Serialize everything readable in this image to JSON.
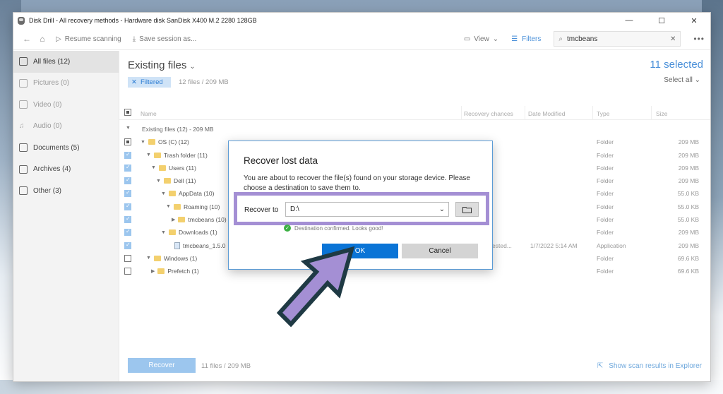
{
  "window": {
    "title": "Disk Drill - All recovery methods - Hardware disk SanDisk X400 M.2 2280 128GB"
  },
  "toolbar": {
    "resume_label": "Resume scanning",
    "save_label": "Save session as...",
    "view_label": "View",
    "filters_label": "Filters",
    "search_value": "tmcbeans"
  },
  "sidebar": {
    "items": [
      {
        "label": "All files (12)"
      },
      {
        "label": "Pictures (0)"
      },
      {
        "label": "Video (0)"
      },
      {
        "label": "Audio (0)"
      },
      {
        "label": "Documents (5)"
      },
      {
        "label": "Archives (4)"
      },
      {
        "label": "Other (3)"
      }
    ]
  },
  "main": {
    "heading": "Existing files",
    "filtered_label": "Filtered",
    "files_info": "12 files / 209 MB",
    "selected_count": "11 selected",
    "select_all": "Select all"
  },
  "table": {
    "headers": {
      "name": "Name",
      "chances": "Recovery chances",
      "date": "Date Modified",
      "type": "Type",
      "size": "Size"
    },
    "group_label": "Existing files (12) - 209 MB",
    "rows": [
      {
        "name": "OS (C) (12)",
        "type": "Folder",
        "size": "209 MB"
      },
      {
        "name": "Trash folder (11)",
        "type": "Folder",
        "size": "209 MB"
      },
      {
        "name": "Users (11)",
        "type": "Folder",
        "size": "209 MB"
      },
      {
        "name": "Dell (11)",
        "type": "Folder",
        "size": "209 MB"
      },
      {
        "name": "AppData (10)",
        "type": "Folder",
        "size": "55.0 KB"
      },
      {
        "name": "Roaming (10)",
        "type": "Folder",
        "size": "55.0 KB"
      },
      {
        "name": "tmcbeans (10)",
        "type": "Folder",
        "size": "55.0 KB"
      },
      {
        "name": "Downloads (1)",
        "type": "Folder",
        "size": "209 MB"
      },
      {
        "name": "tmcbeans_1.5.0",
        "chance": "ested...",
        "date": "1/7/2022 5:14 AM",
        "type": "Application",
        "size": "209 MB"
      },
      {
        "name": "Windows (1)",
        "type": "Folder",
        "size": "69.6 KB"
      },
      {
        "name": "Prefetch (1)",
        "type": "Folder",
        "size": "69.6 KB"
      }
    ]
  },
  "footer": {
    "recover_label": "Recover",
    "info": "11 files / 209 MB",
    "show_results": "Show scan results in Explorer"
  },
  "dialog": {
    "title": "Recover lost data",
    "text": "You are about to recover the file(s) found on your storage device. Please choose a destination to save them to.",
    "recover_to_label": "Recover to",
    "destination": "D:\\",
    "confirm_text": "Destination confirmed. Looks good!",
    "ok_label": "OK",
    "cancel_label": "Cancel"
  },
  "colors": {
    "accent": "#0a74d6",
    "highlight_border": "#a48fd4",
    "arrow_fill": "#a48fd4",
    "arrow_stroke": "#1f3a44"
  }
}
